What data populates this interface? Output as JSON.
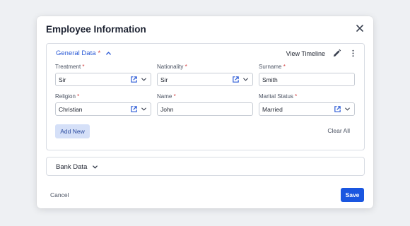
{
  "modal": {
    "title": "Employee Information",
    "cancel_label": "Cancel",
    "save_label": "Save"
  },
  "general": {
    "title": "General Data",
    "required_mark": "*",
    "view_timeline_label": "View Timeline",
    "add_new_label": "Add New",
    "clear_all_label": "Clear All",
    "fields": [
      {
        "label": "Treatment",
        "required": "*",
        "value": "Sir",
        "control": "select-external"
      },
      {
        "label": "Nationality",
        "required": "*",
        "value": "Sir",
        "control": "select-external"
      },
      {
        "label": "Surname",
        "required": "*",
        "value": "Smith",
        "control": "text"
      },
      {
        "label": "Religion",
        "required": "*",
        "value": "Christian",
        "control": "select-external"
      },
      {
        "label": "Name",
        "required": "*",
        "value": "John",
        "control": "text"
      },
      {
        "label": "Marital Status",
        "required": "*",
        "value": "Married",
        "control": "select-external"
      }
    ]
  },
  "bank": {
    "title": "Bank Data"
  },
  "icons": {
    "close": "close-icon",
    "edit": "pencil-icon",
    "more": "kebab-icon",
    "external": "external-link-icon",
    "dropdown": "chevron-down-icon",
    "collapse": "chevron-up-icon"
  },
  "colors": {
    "accent": "#1a56e0",
    "section_title": "#2c5bd6",
    "required": "#d23a3a",
    "add_new_bg": "#d5e0f8"
  }
}
